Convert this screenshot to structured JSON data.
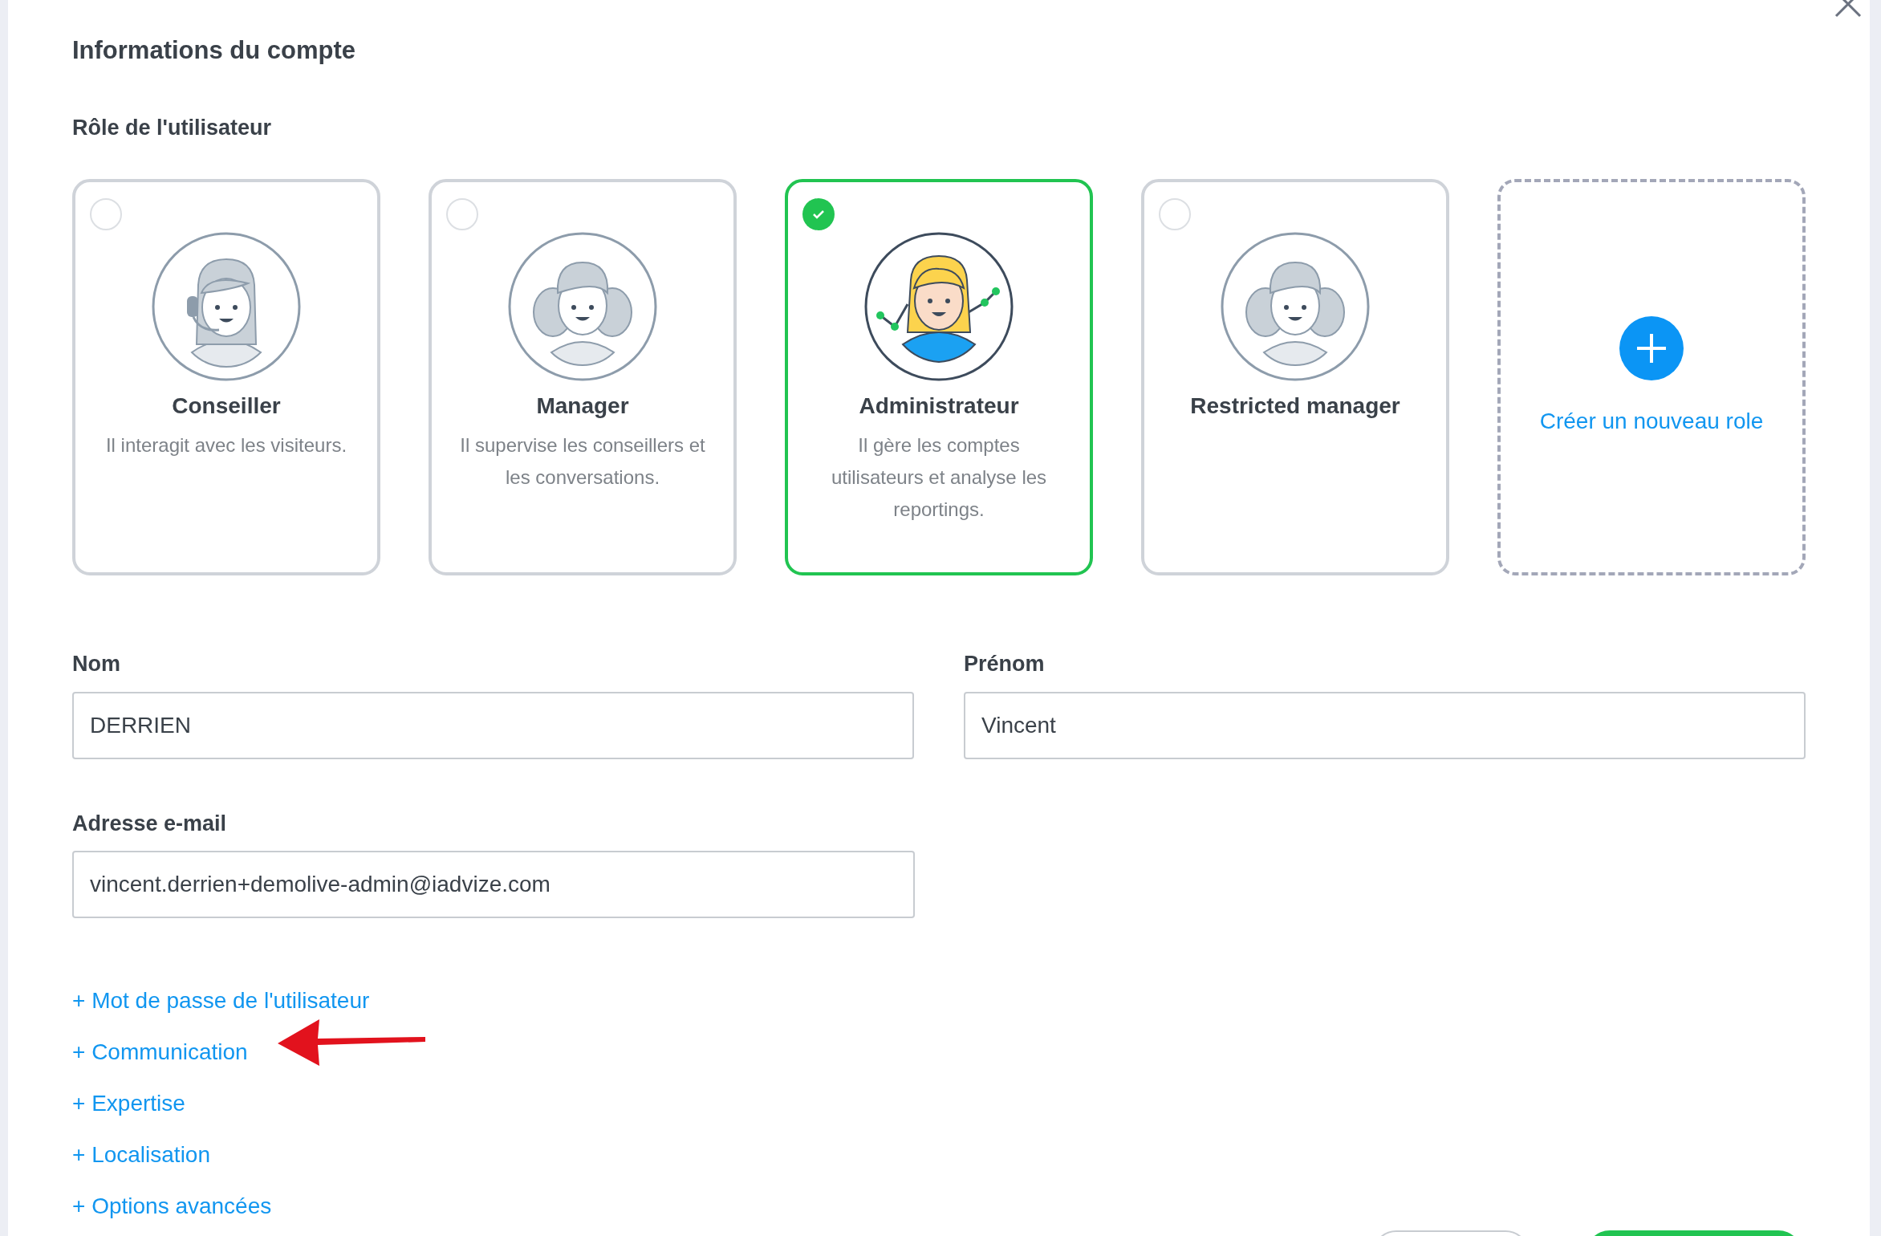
{
  "title": "Informations du compte",
  "role_section": {
    "label": "Rôle de l'utilisateur",
    "roles": [
      {
        "name": "Conseiller",
        "description": "Il interagit avec les visiteurs.",
        "selected": false,
        "kind": "headset"
      },
      {
        "name": "Manager",
        "description": "Il supervise les conseillers et les conversations.",
        "selected": false,
        "kind": "team"
      },
      {
        "name": "Administrateur",
        "description": "Il gère les comptes utilisateurs et analyse les reportings.",
        "selected": true,
        "kind": "admin"
      },
      {
        "name": "Restricted manager",
        "selected": false,
        "kind": "team"
      }
    ],
    "create_role": {
      "label": "Créer un nouveau role"
    }
  },
  "fields": [
    {
      "label": "Nom",
      "value": "DERRIEN"
    },
    {
      "label": "Prénom",
      "value": "Vincent"
    },
    {
      "label": "Adresse e-mail",
      "value": "vincent.derrien+demolive-admin@iadvize.com"
    }
  ],
  "links": [
    "+ Mot de passe de l'utilisateur",
    "+ Communication",
    "+ Expertise",
    "+ Localisation",
    "+ Options avancées"
  ]
}
